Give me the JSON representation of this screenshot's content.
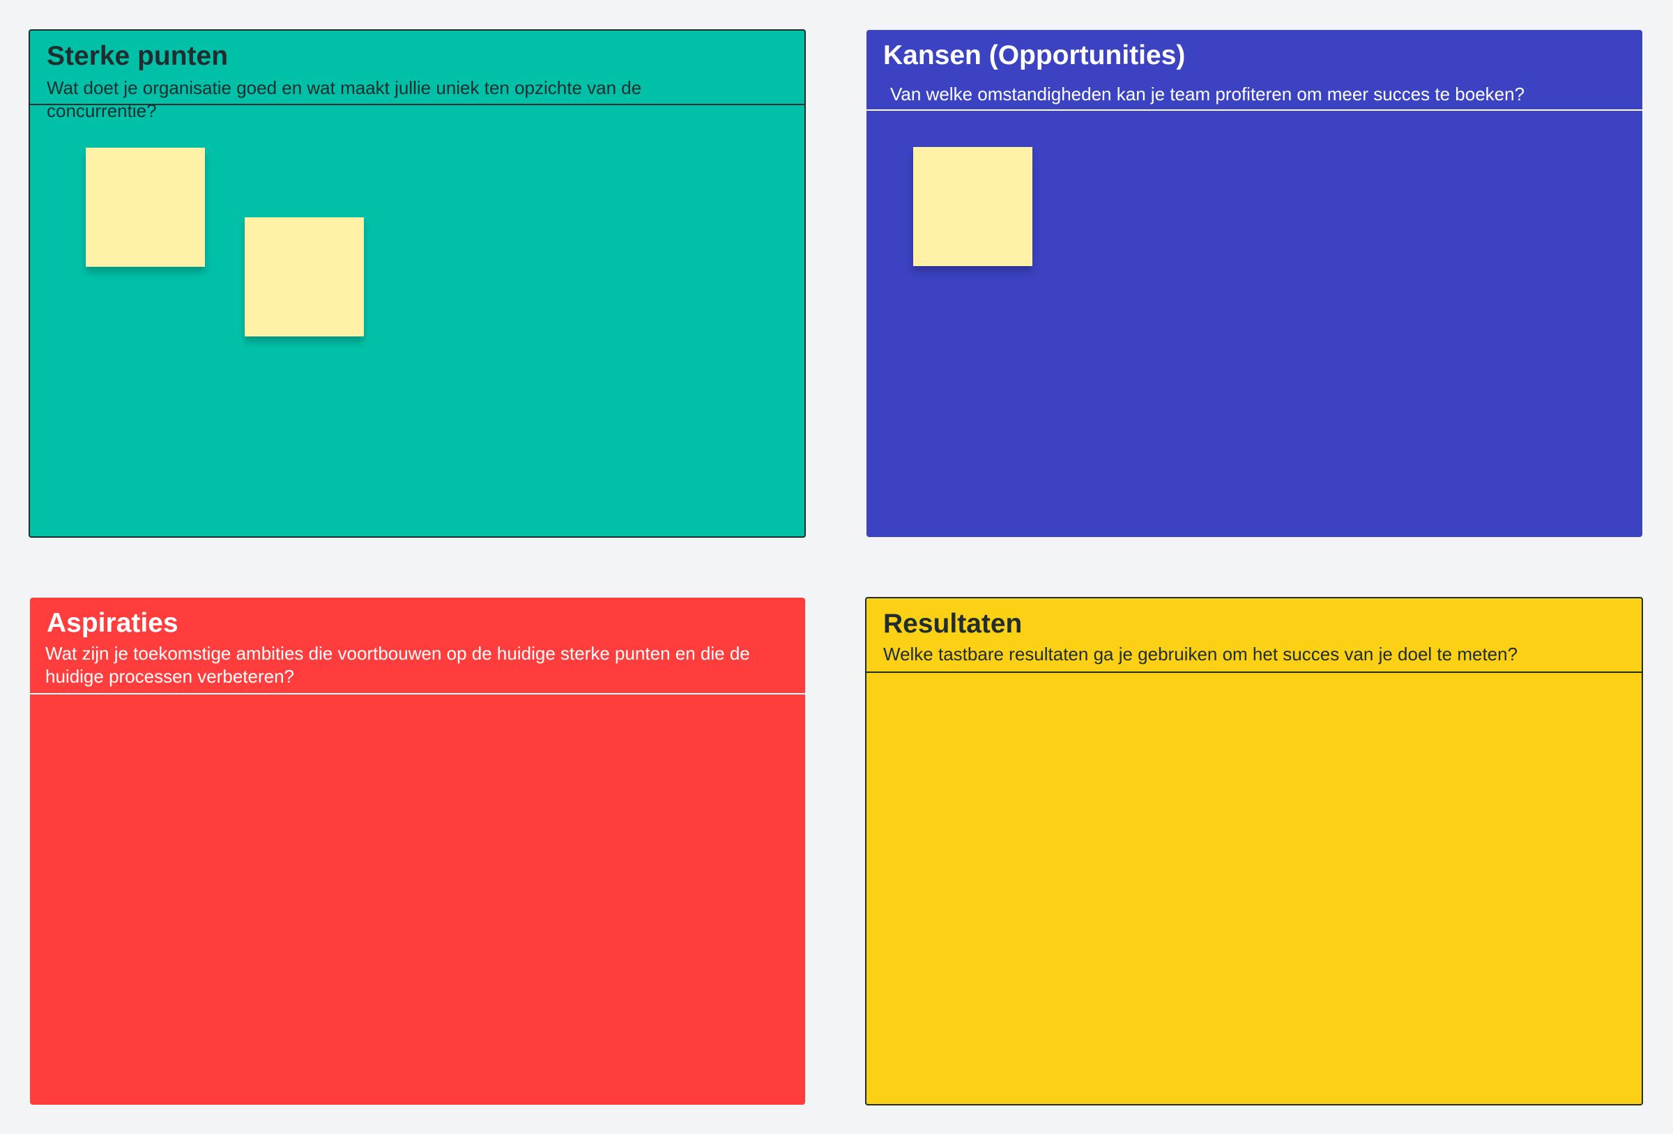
{
  "board": {
    "background_color": "#f3f4f6",
    "frames": [
      {
        "id": "strengths",
        "title": "Sterke punten",
        "subtitle": "Wat doet je organisatie goed en wat maakt jullie uniek ten opzichte van de concurrentie?",
        "color": "#00c1a8",
        "text_color": "#1f2d2f"
      },
      {
        "id": "opportunities",
        "title": "Kansen (Opportunities)",
        "subtitle": "Van welke omstandigheden kan je team profiteren om meer succes te boeken?",
        "color": "#3c43c2",
        "text_color": "#ffffff"
      },
      {
        "id": "aspirations",
        "title": "Aspiraties",
        "subtitle": "Wat zijn je toekomstige ambities die voortbouwen op de huidige sterke punten en die de huidige processen verbeteren?",
        "color": "#ff3d3d",
        "text_color": "#ffffff"
      },
      {
        "id": "results",
        "title": "Resultaten",
        "subtitle": "Welke tastbare resultaten ga je gebruiken om het succes van je doel te meten?",
        "color": "#fcd015",
        "text_color": "#1f2d2f"
      }
    ],
    "sticky_note_color": "#fff1a6"
  }
}
